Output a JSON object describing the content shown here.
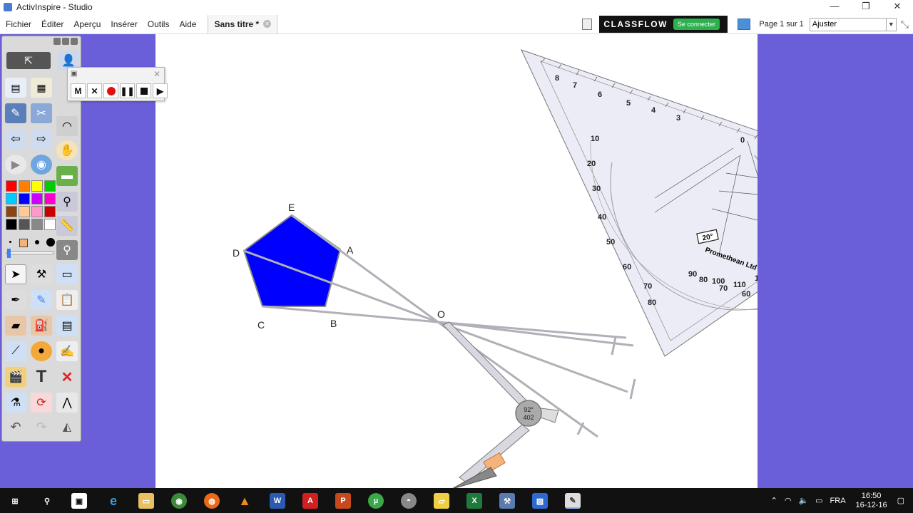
{
  "window": {
    "title": "ActivInspire - Studio",
    "controls": [
      "—",
      "❐",
      "✕"
    ]
  },
  "menu": {
    "items": [
      "Fichier",
      "Éditer",
      "Aperçu",
      "Insérer",
      "Outils",
      "Aide"
    ]
  },
  "document_tab": {
    "label": "Sans titre *"
  },
  "classflow": {
    "brand": "CLASSFLOW",
    "connect_label": "Se connecter"
  },
  "page_nav": {
    "label": "Page 1 sur 1",
    "zoom_value": "Ajuster"
  },
  "figure": {
    "points": [
      "E",
      "A",
      "B",
      "C",
      "D",
      "O"
    ],
    "compass_label_angle": "92°",
    "compass_label_length": "402",
    "set_square_angle": "20°",
    "set_square_brand": "Promethean Ltd"
  },
  "colors": {
    "pentagon": "#0000ff",
    "background": "#6a5fd9",
    "palette": [
      "#ff0000",
      "#ff8000",
      "#ffff00",
      "#00cc00",
      "#00ccff",
      "#0000ff",
      "#cc00ff",
      "#ff00cc",
      "#8b4513",
      "#ffcc99",
      "#ff99cc",
      "#cc0000",
      "#000000",
      "#555555",
      "#888888",
      "#ffffff"
    ]
  },
  "taskbar": {
    "language": "FRA",
    "time": "16:50",
    "date": "16-12-16"
  }
}
